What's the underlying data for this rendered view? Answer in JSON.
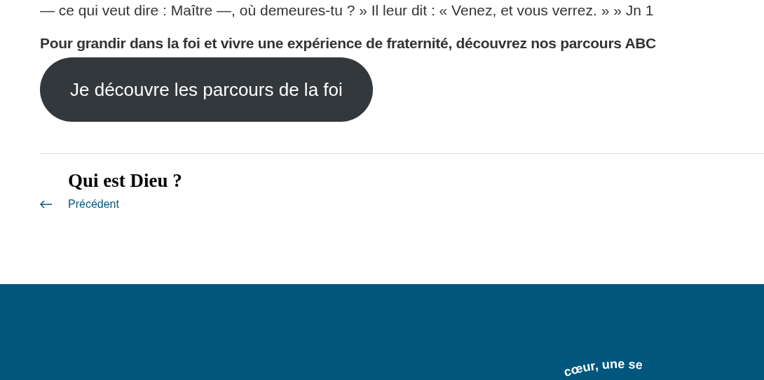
{
  "article": {
    "quote_line": "— ce qui veut dire : Maître —, où demeures-tu ? » Il leur dit : « Venez, et vous verrez. » » Jn 1",
    "cta_text": "Pour grandir dans la foi et vivre une expérience de fraternité, découvrez nos parcours ABC",
    "cta_button": "Je découvre les parcours de la foi"
  },
  "post_navigation": {
    "title": "Qui est Dieu ?",
    "link": "Précédent"
  },
  "footer": {
    "tagline": "cœur, une se"
  }
}
